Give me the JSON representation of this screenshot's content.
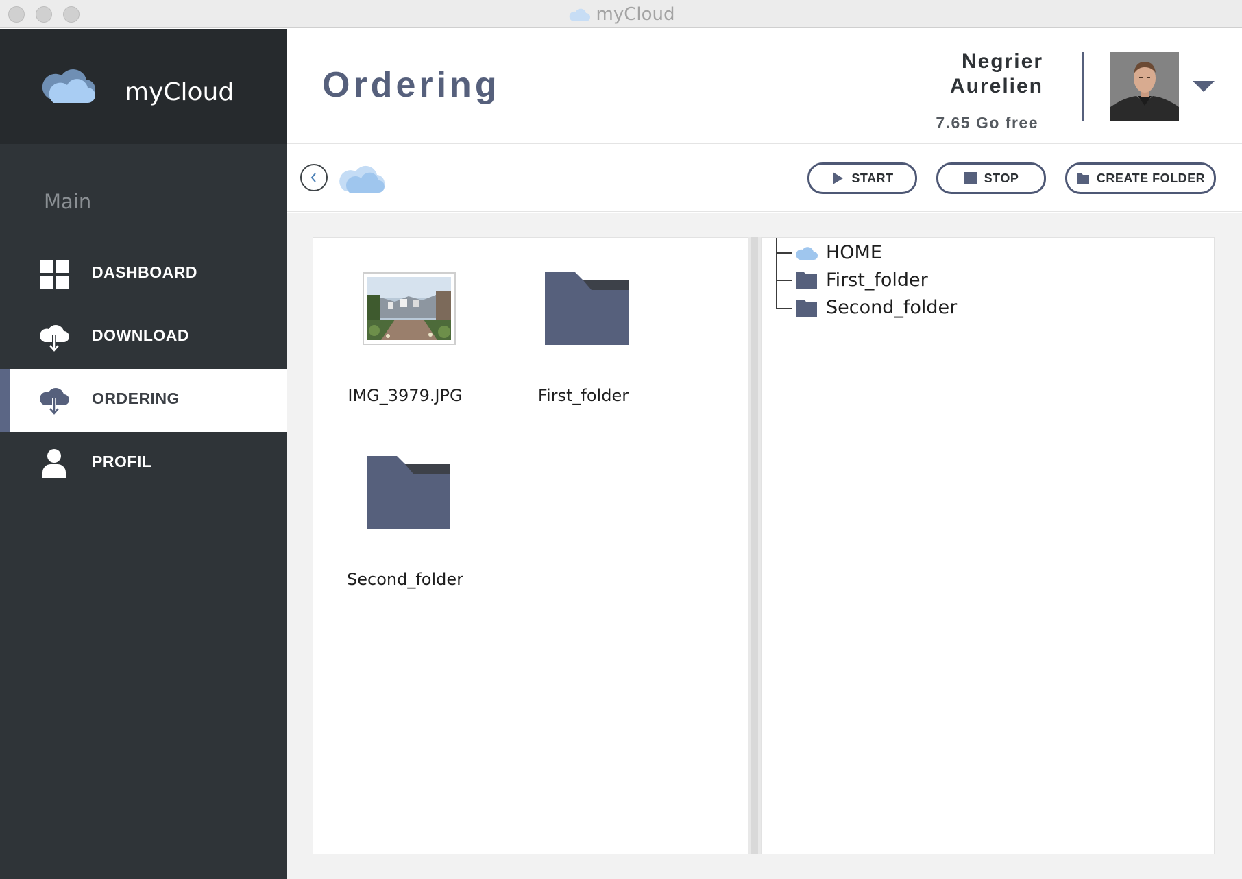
{
  "window": {
    "title": "myCloud"
  },
  "brand": {
    "name": "myCloud"
  },
  "sidebar": {
    "section_label": "Main",
    "items": [
      {
        "label": "DASHBOARD",
        "icon": "dashboard-grid-icon",
        "active": false
      },
      {
        "label": "DOWNLOAD",
        "icon": "cloud-download-icon",
        "active": false
      },
      {
        "label": "ORDERING",
        "icon": "cloud-download-icon",
        "active": true
      },
      {
        "label": "PROFIL",
        "icon": "user-icon",
        "active": false
      }
    ]
  },
  "header": {
    "title": "Ordering",
    "user_first": "Negrier",
    "user_last": "Aurelien",
    "quota": "7.65 Go free"
  },
  "toolbar": {
    "start_label": "START",
    "stop_label": "STOP",
    "create_folder_label": "CREATE FOLDER"
  },
  "files": [
    {
      "name": "IMG_3979.JPG",
      "type": "image"
    },
    {
      "name": "First_folder",
      "type": "folder"
    },
    {
      "name": "Second_folder",
      "type": "folder"
    }
  ],
  "tree": [
    {
      "label": "HOME",
      "icon": "cloud-icon"
    },
    {
      "label": "First_folder",
      "icon": "folder-icon"
    },
    {
      "label": "Second_folder",
      "icon": "folder-icon"
    }
  ],
  "colors": {
    "sidebar_bg": "#2f3438",
    "brand_bg": "#262a2d",
    "accent": "#5b6685",
    "folder": "#56607c",
    "cloud": "#9fc6ee"
  }
}
